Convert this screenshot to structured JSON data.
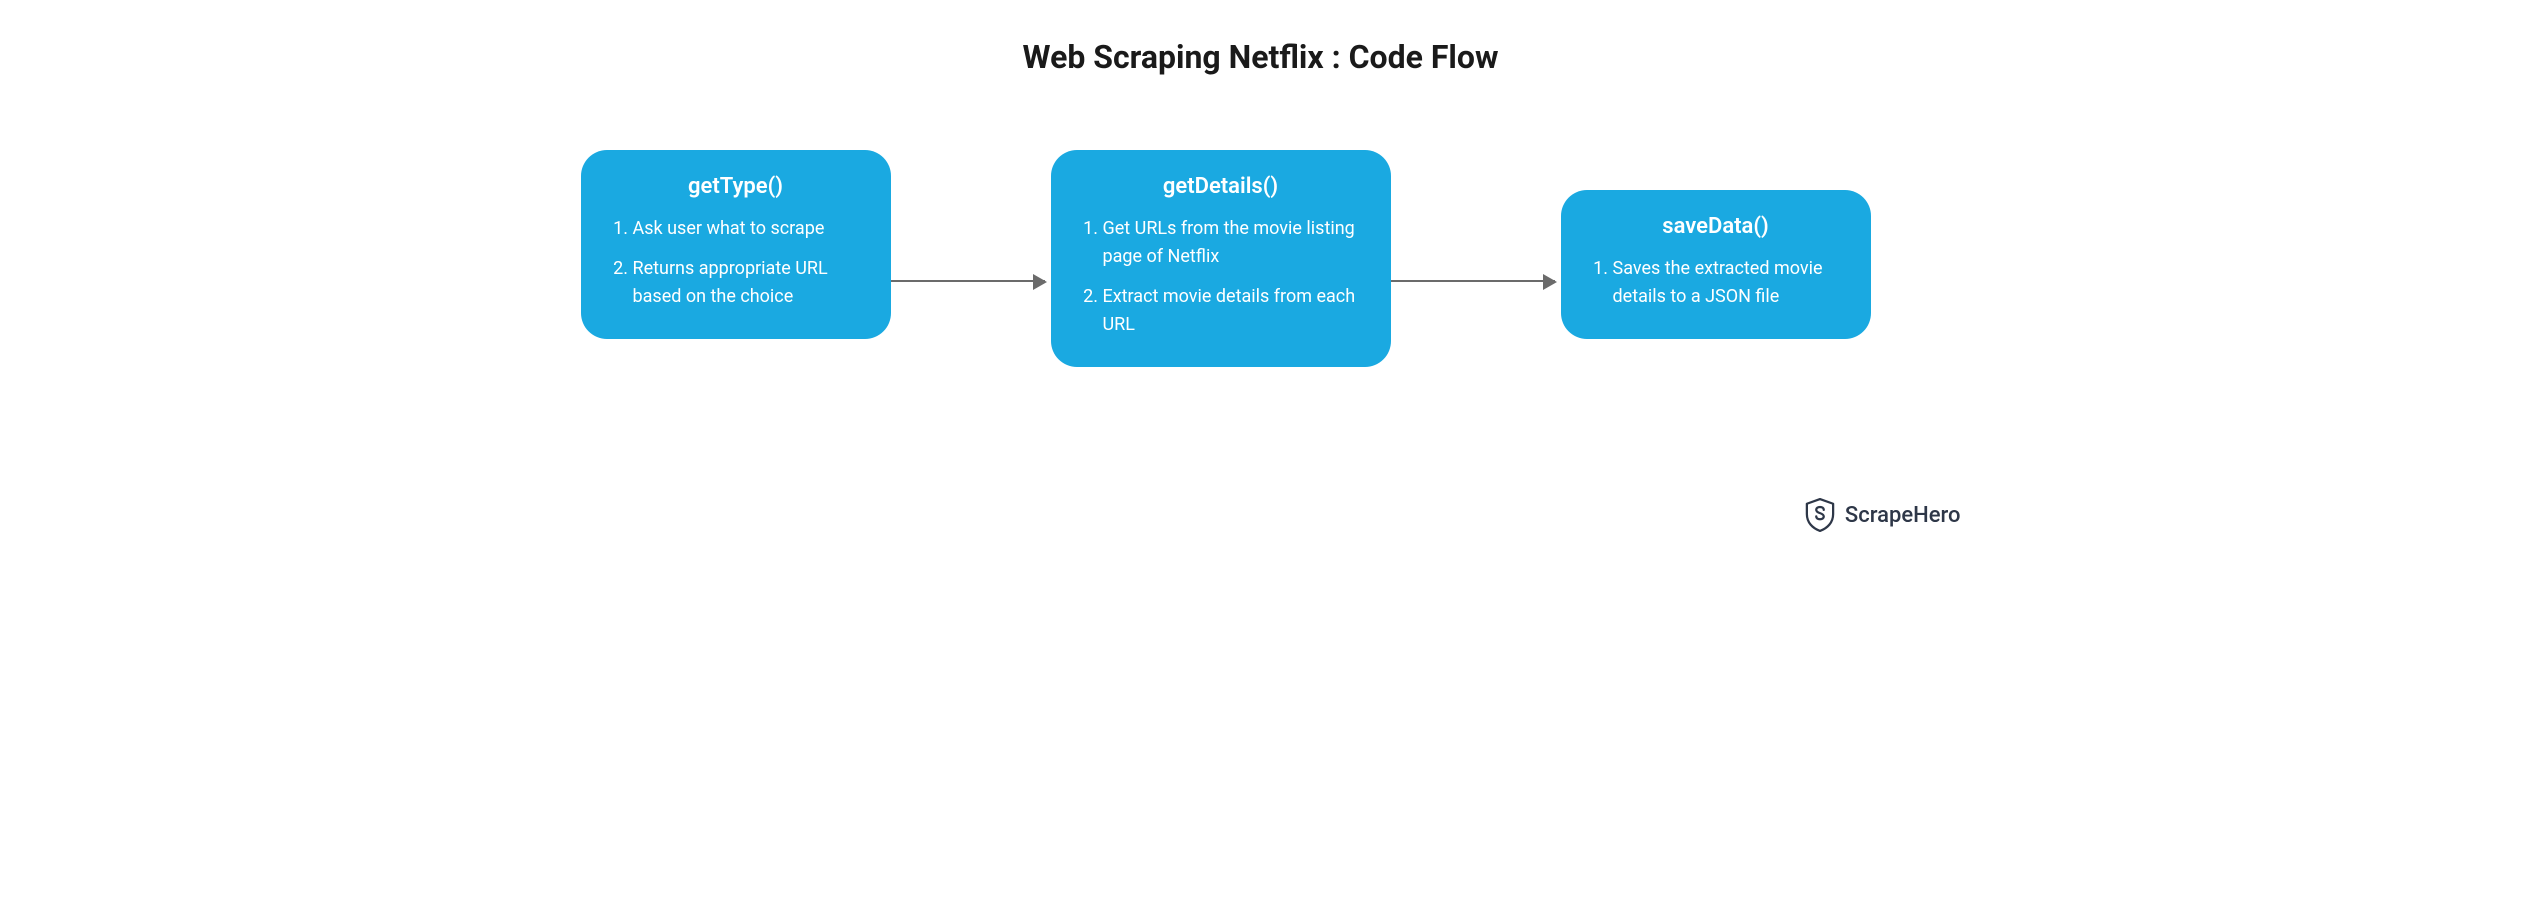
{
  "title": "Web Scraping Netflix : Code Flow",
  "boxes": [
    {
      "name": "getType()",
      "items": [
        "Ask user what to scrape",
        "Returns appropriate URL based on the choice"
      ]
    },
    {
      "name": "getDetails()",
      "items": [
        "Get URLs from the movie listing page of Netflix",
        "Extract movie details from each URL"
      ]
    },
    {
      "name": "saveData()",
      "items": [
        "Saves the extracted movie details to a JSON file"
      ]
    }
  ],
  "brand": "ScrapeHero",
  "colors": {
    "box_bg": "#1aa9e1",
    "box_fg": "#ffffff",
    "arrow": "#6b6b6b",
    "brand": "#2e3748"
  }
}
